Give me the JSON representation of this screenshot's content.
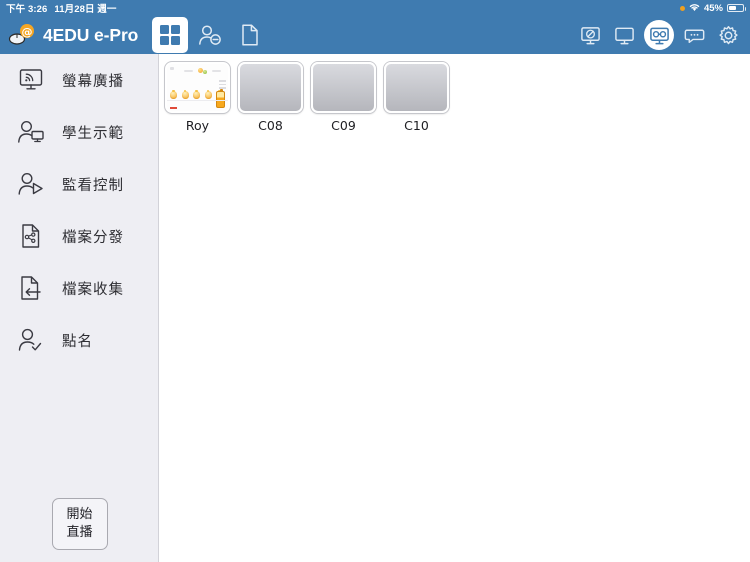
{
  "statusbar": {
    "time": "下午 3:26",
    "date": "11月28日 週一",
    "battery_percent": "45%",
    "wifi_icon": "wifi-icon",
    "recording_dot": "orange-status-dot"
  },
  "header": {
    "brand_title": "4EDU e-Pro",
    "logo_icon": "mouse-at-logo-icon",
    "tabs": [
      {
        "name": "grid-view",
        "icon": "grid-view-icon",
        "active": true
      },
      {
        "name": "student-remove",
        "icon": "person-minus-icon",
        "active": false
      },
      {
        "name": "document",
        "icon": "document-icon",
        "active": false
      }
    ],
    "right_buttons": [
      {
        "name": "blank-screen",
        "icon": "screen-blocked-icon",
        "active": false
      },
      {
        "name": "monitor",
        "icon": "monitor-icon",
        "active": false
      },
      {
        "name": "screen-share",
        "icon": "connected-monitor-icon",
        "active": true
      },
      {
        "name": "message",
        "icon": "chat-bubble-icon",
        "active": false
      },
      {
        "name": "settings",
        "icon": "gear-icon",
        "active": false
      }
    ]
  },
  "sidebar": {
    "items": [
      {
        "label": "螢幕廣播",
        "icon": "screen-broadcast-icon"
      },
      {
        "label": "學生示範",
        "icon": "student-demo-icon"
      },
      {
        "label": "監看控制",
        "icon": "monitor-control-icon"
      },
      {
        "label": "檔案分發",
        "icon": "file-distribute-icon"
      },
      {
        "label": "檔案收集",
        "icon": "file-collect-icon"
      },
      {
        "label": "點名",
        "icon": "roll-call-icon"
      }
    ],
    "live_button": {
      "line1": "開始",
      "line2": "直播"
    }
  },
  "content": {
    "thumbnails": [
      {
        "label": "Roy",
        "live": true
      },
      {
        "label": "C08",
        "live": false
      },
      {
        "label": "C09",
        "live": false
      },
      {
        "label": "C10",
        "live": false
      }
    ]
  },
  "colors": {
    "header_blue": "#3f7bb0",
    "sidebar_bg": "#eeeef3",
    "content_bg": "#ffffff",
    "thumb_top": "#d9dadf",
    "thumb_bottom": "#b5b6bc",
    "accent_orange": "#f5a623"
  }
}
